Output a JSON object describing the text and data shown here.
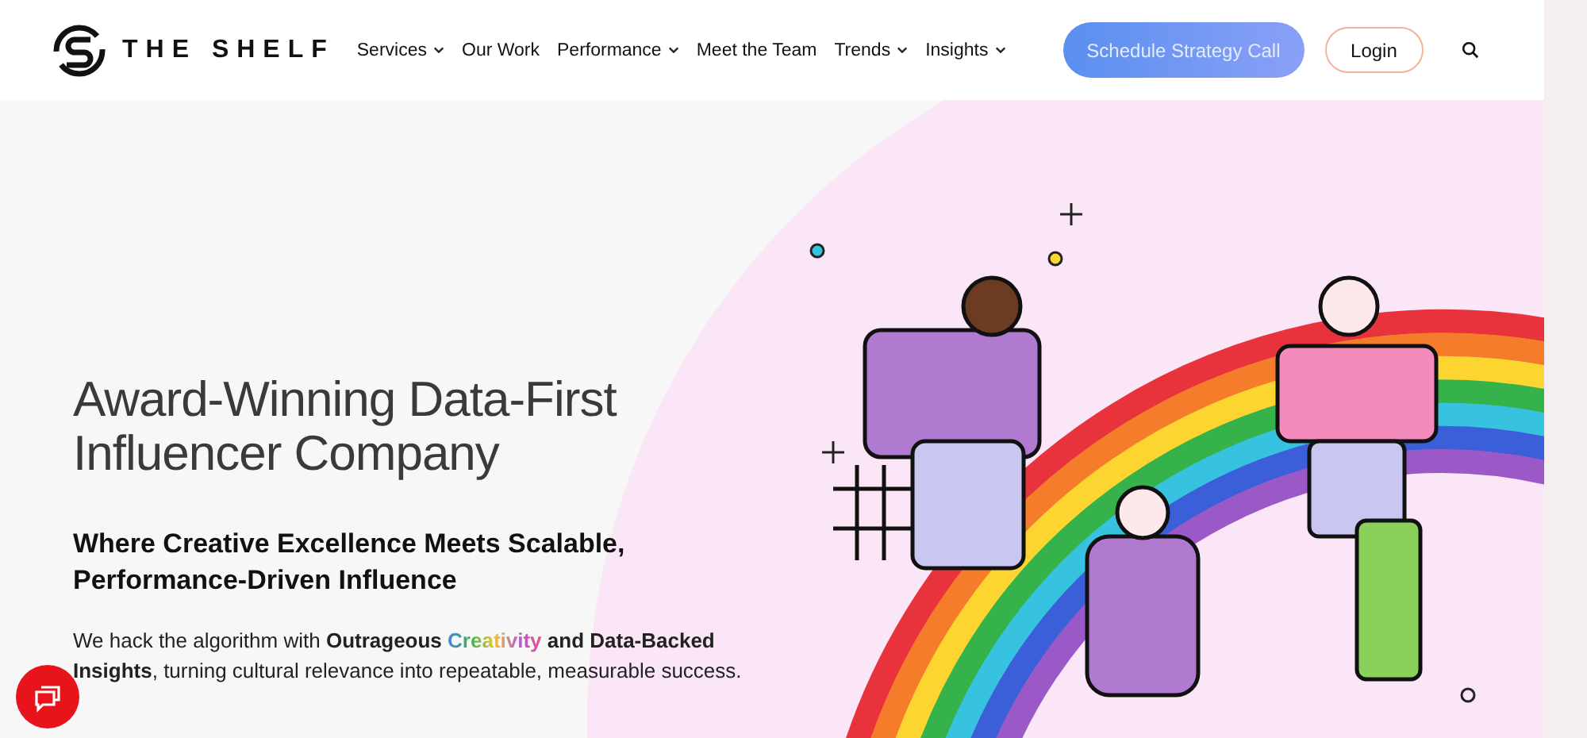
{
  "header": {
    "logo_text": "THE SHELF",
    "nav": [
      {
        "label": "Services",
        "has_menu": true
      },
      {
        "label": "Our Work",
        "has_menu": false
      },
      {
        "label": "Performance",
        "has_menu": true
      },
      {
        "label": "Meet the Team",
        "has_menu": false
      },
      {
        "label": "Trends",
        "has_menu": true
      },
      {
        "label": "Insights",
        "has_menu": true
      }
    ],
    "cta_button": "Schedule Strategy Call",
    "login_button": "Login"
  },
  "hero": {
    "headline": "Award-Winning Data-First Influencer Company",
    "subheadline": "Where Creative Excellence Meets Scalable, Performance-Driven Influence",
    "paragraph": [
      {
        "kind": "plain",
        "text": "We hack the algorithm with "
      },
      {
        "kind": "bold",
        "text": "Outrageous "
      },
      {
        "kind": "rainbow",
        "text": "Creativity"
      },
      {
        "kind": "bold",
        "text": " and Data-Backed Insights"
      },
      {
        "kind": "plain",
        "text": ", turning cultural relevance into repeatable, measurable success."
      }
    ]
  }
}
